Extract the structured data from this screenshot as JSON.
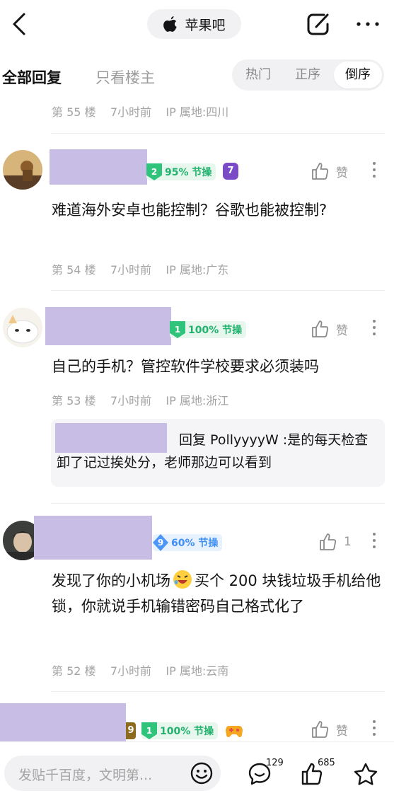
{
  "header": {
    "forum_name": "苹果吧"
  },
  "tabs": {
    "all_replies": "全部回复",
    "only_op": "只看楼主",
    "sort_options": [
      "热门",
      "正序",
      "倒序"
    ],
    "sort_selected": "倒序"
  },
  "top_floor": {
    "meta": "第 55 楼    7小时前    IP 属地:四川"
  },
  "posts": [
    {
      "badge_level": "2",
      "badge_text": "95% 节操",
      "extra_badge": "7",
      "like_label": "赞",
      "content": "难道海外安卓也能控制？谷歌也能被控制?",
      "meta": "第 54 楼    7小时前    IP 属地:广东"
    },
    {
      "badge_level": "1",
      "badge_text": "100% 节操",
      "like_label": "赞",
      "content": "自己的手机？管控软件学校要求必须装吗",
      "meta": "第 53 楼    7小时前    IP 属地:浙江",
      "reply": {
        "text": "回复 PollyyyyW :是的每天检查卸了记过挨处分，老师那边可以看到"
      }
    },
    {
      "badge_level": "9",
      "badge_text": "60% 节操",
      "like_label": "1",
      "content_before": "发现了你的小机场",
      "content_after": "买个 200 块钱垃圾手机给他锁，你就说手机输错密码自己格式化了",
      "meta": "第 52 楼    7小时前    IP 属地:云南"
    },
    {
      "prefix_level": "9",
      "badge_level": "1",
      "badge_text": "100% 节操",
      "like_label": "赞"
    }
  ],
  "bottom_bar": {
    "input_placeholder": "发贴千百度，文明第...",
    "comment_count": "129",
    "like_count": "685"
  },
  "colors": {
    "redaction": "#c8bde4",
    "badge_green": "#21b26d",
    "badge_blue": "#3e8ff5",
    "meta_gray": "#a3a3a3"
  }
}
